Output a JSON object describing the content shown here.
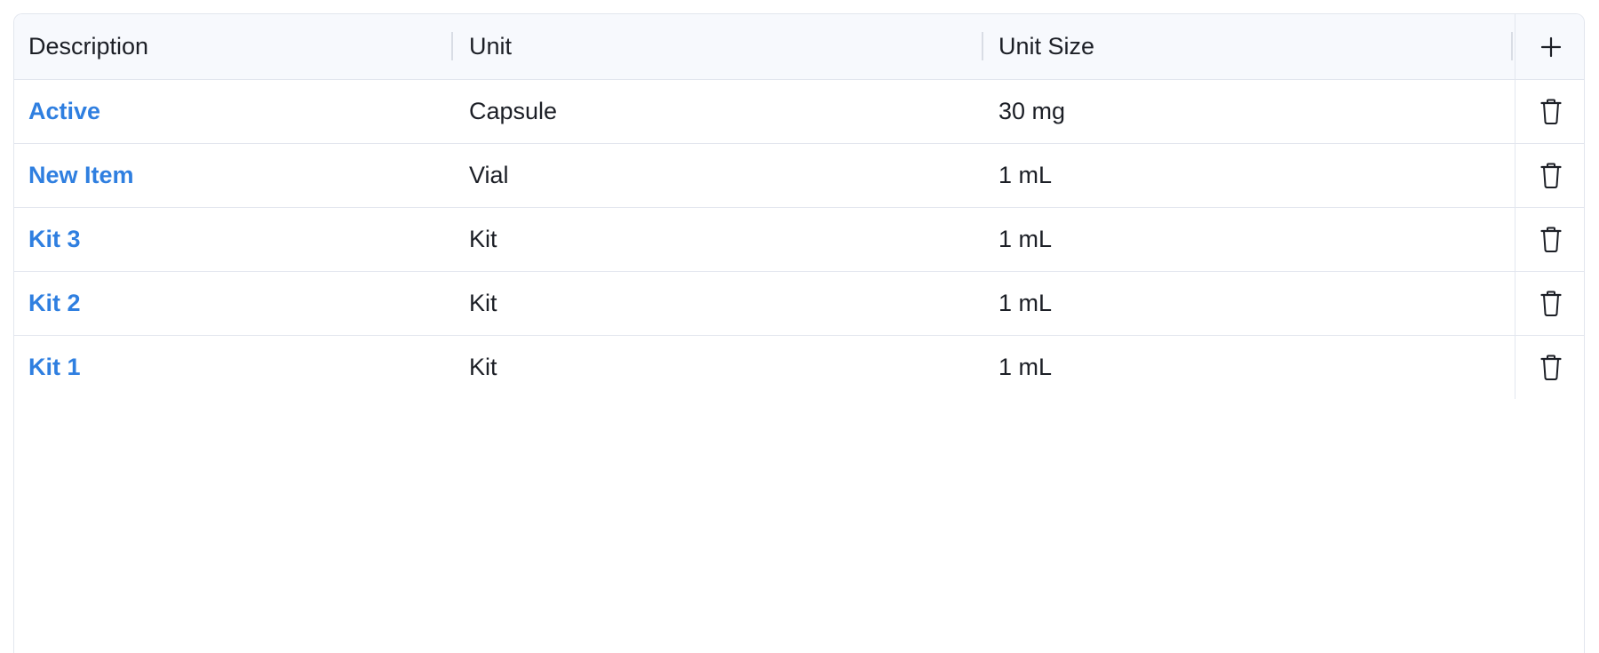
{
  "table": {
    "columns": [
      "Description",
      "Unit",
      "Unit Size"
    ],
    "add_icon": "plus-icon",
    "delete_icon": "trash-icon",
    "link_color": "#2f7fe0",
    "rows": [
      {
        "description": "Active",
        "unit": "Capsule",
        "unit_size": "30 mg"
      },
      {
        "description": "New Item",
        "unit": "Vial",
        "unit_size": "1 mL"
      },
      {
        "description": "Kit 3",
        "unit": "Kit",
        "unit_size": "1 mL"
      },
      {
        "description": "Kit 2",
        "unit": "Kit",
        "unit_size": "1 mL"
      },
      {
        "description": "Kit 1",
        "unit": "Kit",
        "unit_size": "1 mL"
      }
    ]
  }
}
